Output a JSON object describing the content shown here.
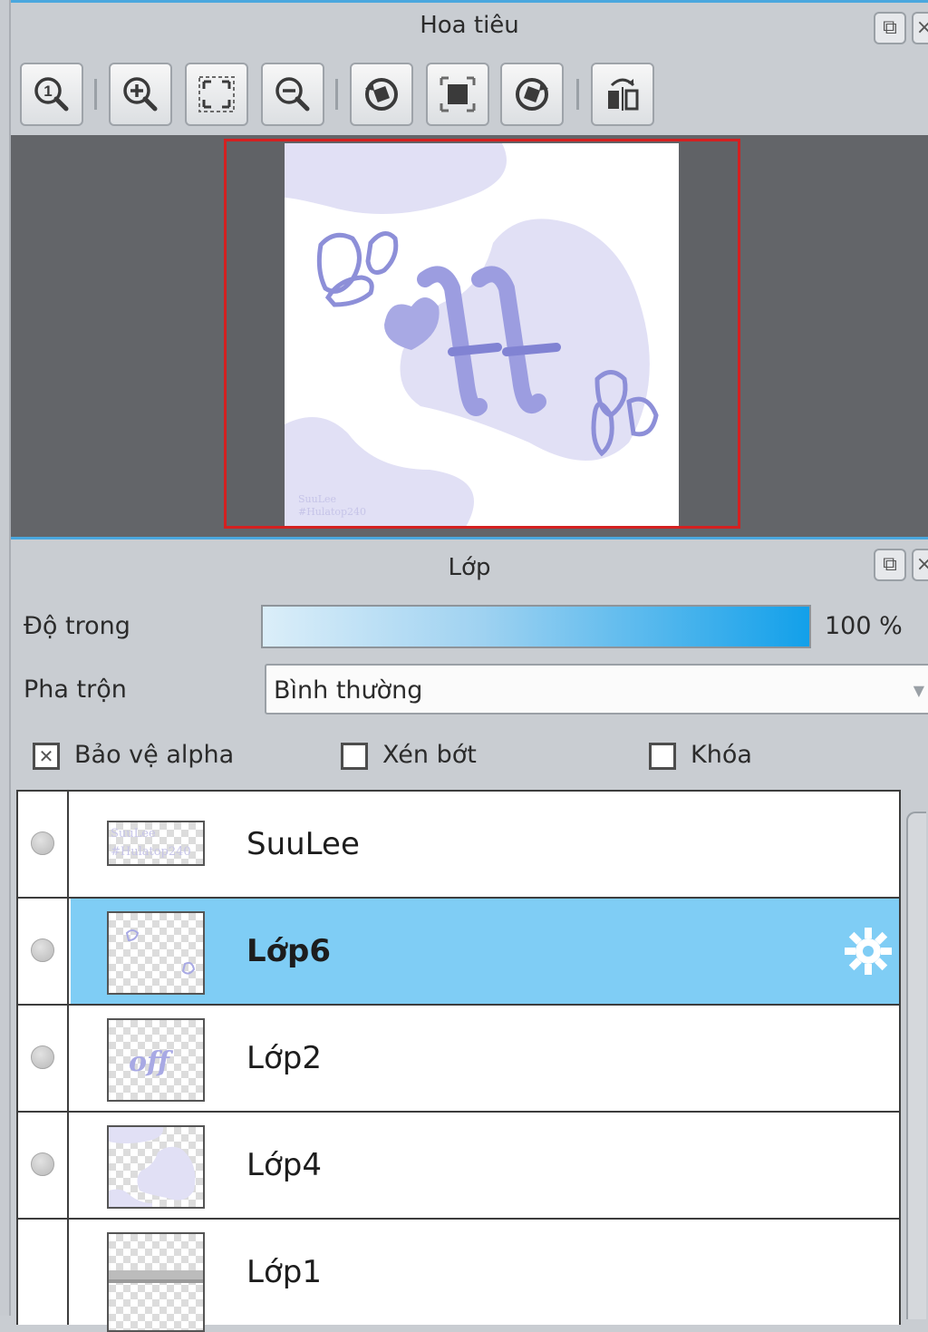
{
  "navigator": {
    "title": "Hoa tiêu",
    "toolbar": [
      {
        "name": "zoom-actual-size-icon"
      },
      {
        "name": "zoom-in-icon"
      },
      {
        "name": "fit-to-window-icon"
      },
      {
        "name": "zoom-out-icon"
      },
      {
        "name": "rotate-left-icon"
      },
      {
        "name": "reset-view-icon"
      },
      {
        "name": "rotate-right-icon"
      },
      {
        "name": "flip-horizontal-icon"
      }
    ],
    "preview_border_color": "#d42020"
  },
  "layers_panel": {
    "title": "Lớp",
    "opacity_label": "Độ trong",
    "opacity_value": "100 %",
    "opacity_fraction": 1.0,
    "blend_label": "Pha trộn",
    "blend_value": "Bình thường",
    "protect_alpha": {
      "label": "Bảo vệ alpha",
      "checked": true
    },
    "clipping": {
      "label": "Xén bớt",
      "checked": false
    },
    "lock": {
      "label": "Khóa",
      "checked": false
    },
    "layers": [
      {
        "name": "SuuLee",
        "selected": false
      },
      {
        "name": "Lớp6",
        "selected": true
      },
      {
        "name": "Lớp2",
        "selected": false
      },
      {
        "name": "Lớp4",
        "selected": false
      },
      {
        "name": "Lớp1",
        "selected": false
      }
    ],
    "selection_color": "#7fcdf5"
  }
}
